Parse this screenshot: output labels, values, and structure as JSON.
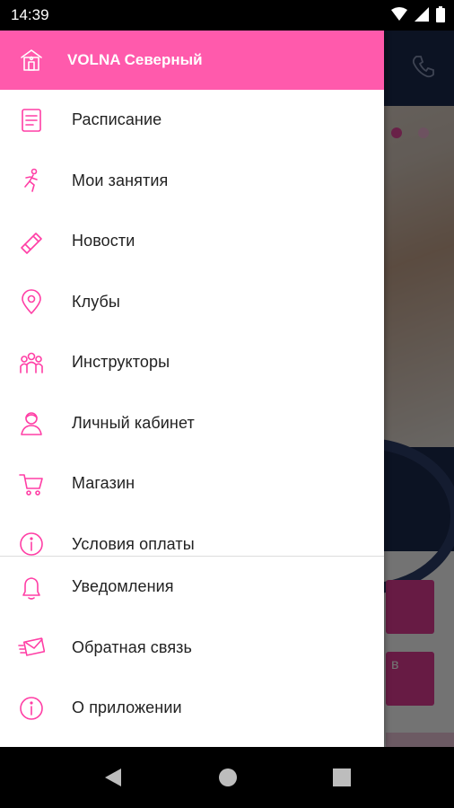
{
  "status_bar": {
    "time": "14:39"
  },
  "drawer": {
    "header_title": "VOLNA Северный",
    "main_items": [
      {
        "label": "Расписание",
        "icon": "schedule-icon"
      },
      {
        "label": "Мои занятия",
        "icon": "runner-icon"
      },
      {
        "label": "Новости",
        "icon": "megaphone-icon"
      },
      {
        "label": "Клубы",
        "icon": "location-pin-icon"
      },
      {
        "label": "Инструкторы",
        "icon": "group-icon"
      },
      {
        "label": "Личный кабинет",
        "icon": "person-icon"
      },
      {
        "label": "Магазин",
        "icon": "cart-icon"
      },
      {
        "label": "Условия оплаты",
        "icon": "info-icon"
      }
    ],
    "secondary_items": [
      {
        "label": "Уведомления",
        "icon": "bell-icon"
      },
      {
        "label": "Обратная связь",
        "icon": "envelope-icon"
      },
      {
        "label": "О приложении",
        "icon": "info-icon"
      }
    ]
  },
  "background": {
    "partial_button_text": "в"
  },
  "colors": {
    "accent": "#ff5aac",
    "icon": "#ff3ea5",
    "header_bg": "#1c2a4e"
  }
}
